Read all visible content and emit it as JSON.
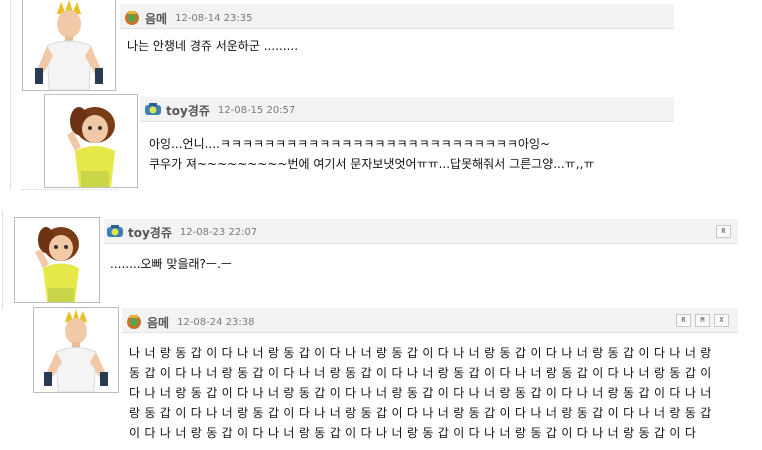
{
  "comments": [
    {
      "nick": "음메",
      "date": "12-08-14 23:35",
      "text": "나는 안챙네 경쥬 서운하군 .........",
      "avatar": "boy-avatar"
    },
    {
      "nick": "toy경쥬",
      "date": "12-08-15 20:57",
      "text": "아잉...언니....ㅋㅋㅋㅋㅋㅋㅋㅋㅋㅋㅋㅋㅋㅋㅋㅋㅋㅋㅋㅋㅋㅋㅋㅋㅋㅋㅋ아잉~\n쿠우가 져~~~~~~~~~번에 여기서 문자보냇엇어ㅠㅠ...답못해줘서 그른그양...ㅠ,,ㅠ",
      "avatar": "girl-avatar"
    },
    {
      "nick": "toy경쥬",
      "date": "12-08-23 22:07",
      "text": "........오빠 맞을래?ㅡ.ㅡ",
      "avatar": "girl-avatar"
    },
    {
      "nick": "음메",
      "date": "12-08-24 23:38",
      "text": "나너랑동갑이다나너랑동갑이다나너랑동갑이다나너랑동갑이다나너랑동갑이다나너랑동갑이다나너랑동갑이다나너랑동갑이다나너랑동갑이다나너랑동갑이다나너랑동갑이다나너랑동갑이다나너랑동갑이다나너랑동갑이다나너랑동갑이다나너랑동갑이다나너랑동갑이다나너랑동갑이다나너랑동갑이다나너랑동갑이다나너랑동갑이다나너랑동갑이다나너랑동갑이다나너랑동갑이다나너랑동갑이다나너랑동갑이다나너랑동갑이다",
      "avatar": "boy-avatar"
    }
  ],
  "buttons": {
    "reply": "R",
    "modify": "M",
    "delete": "X"
  },
  "colors": {
    "header_bg": "#f3f3f3",
    "nick": "#555555",
    "date": "#7a7a7a",
    "border": "#bdbdbd"
  }
}
